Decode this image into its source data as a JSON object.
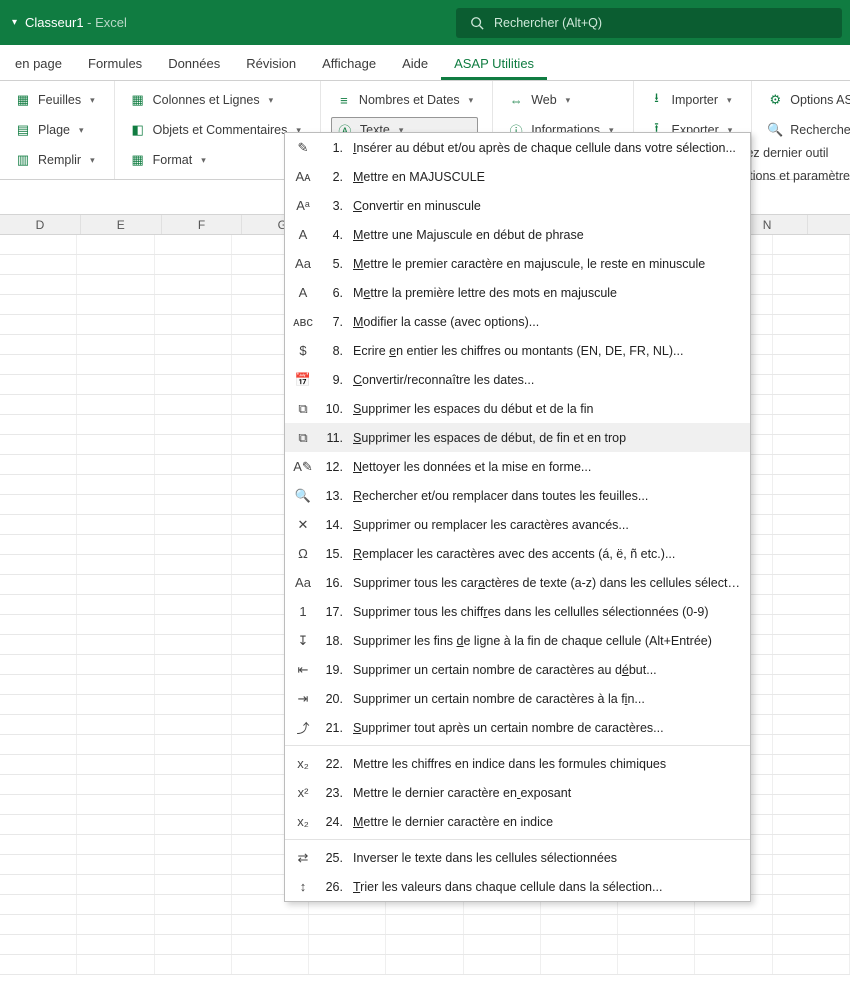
{
  "title": {
    "book": "Classeur1",
    "sep": "  -  ",
    "app": "Excel"
  },
  "search": {
    "placeholder": "Rechercher (Alt+Q)"
  },
  "tabs": [
    "en page",
    "Formules",
    "Données",
    "Révision",
    "Affichage",
    "Aide",
    "ASAP Utilities"
  ],
  "ribbon": {
    "g1": {
      "a": "Feuilles",
      "b": "Plage",
      "c": "Remplir"
    },
    "g2": {
      "a": "Colonnes et Lignes",
      "b": "Objets et Commentaires",
      "c": "Format"
    },
    "g3": {
      "a": "Nombres et Dates",
      "b": "Texte"
    },
    "g4": {
      "a": "Web",
      "b": "Informations"
    },
    "g5": {
      "a": "Importer",
      "b": "Exporter"
    },
    "g6": {
      "a": "Options ASAP Utilities",
      "b": "Rechercher et démarrer un"
    }
  },
  "sidecut": {
    "a": "rez dernier outil",
    "b": "ptions et paramètre"
  },
  "columns": [
    "D",
    "E",
    "F",
    "G",
    "",
    "",
    "",
    "",
    "",
    "N"
  ],
  "menu": [
    {
      "n": "1.",
      "ico": "✎",
      "t": "Insérer au début et/ou après de chaque cellule dans votre sélection...",
      "u": 0
    },
    {
      "n": "2.",
      "ico": "Aᴀ",
      "t": "Mettre en MAJUSCULE",
      "u": 0
    },
    {
      "n": "3.",
      "ico": "Aᵃ",
      "t": "Convertir en minuscule",
      "u": 0
    },
    {
      "n": "4.",
      "ico": "A",
      "t": "Mettre une Majuscule en début de phrase",
      "u": 0
    },
    {
      "n": "5.",
      "ico": "Aa",
      "t": "Mettre le premier caractère en majuscule, le reste en minuscule",
      "u": 0
    },
    {
      "n": "6.",
      "ico": "A",
      "t": "Mettre la première lettre des mots en majuscule",
      "u": 1
    },
    {
      "n": "7.",
      "ico": "ᴀʙᴄ",
      "t": "Modifier la casse (avec options)...",
      "u": 0
    },
    {
      "n": "8.",
      "ico": "$",
      "t": "Ecrire en entier les chiffres ou montants (EN, DE, FR, NL)...",
      "u": 7
    },
    {
      "n": "9.",
      "ico": "📅",
      "t": "Convertir/reconnaître les dates...",
      "u": 0
    },
    {
      "n": "10.",
      "ico": "⧉",
      "t": "Supprimer les espaces du début et de la fin",
      "u": 0
    },
    {
      "n": "11.",
      "ico": "⧉",
      "t": "Supprimer les espaces de début, de fin et en trop",
      "u": 0,
      "hover": true
    },
    {
      "n": "12.",
      "ico": "A✎",
      "t": "Nettoyer les données et la mise en forme...",
      "u": 0
    },
    {
      "n": "13.",
      "ico": "🔍",
      "t": "Rechercher et/ou remplacer dans toutes les feuilles...",
      "u": 0
    },
    {
      "n": "14.",
      "ico": "✕",
      "t": "Supprimer ou remplacer les caractères avancés...",
      "u": 0
    },
    {
      "n": "15.",
      "ico": "Ω",
      "t": "Remplacer les caractères avec des accents (á, ë, ñ etc.)...",
      "u": 0
    },
    {
      "n": "16.",
      "ico": "Aa",
      "t": "Supprimer tous les caractères de texte (a-z) dans les cellules sélectionnées",
      "u": 22
    },
    {
      "n": "17.",
      "ico": "1",
      "t": "Supprimer tous les chiffres dans les cellulles sélectionnées (0-9)",
      "u": 24
    },
    {
      "n": "18.",
      "ico": "↧",
      "t": "Supprimer les fins de ligne à la fin de chaque cellule (Alt+Entrée)",
      "u": 19
    },
    {
      "n": "19.",
      "ico": "⇤",
      "t": "Supprimer un certain nombre de caractères au début...",
      "u": 46
    },
    {
      "n": "20.",
      "ico": "⇥",
      "t": "Supprimer un certain nombre de caractères à la fin...",
      "u": 48
    },
    {
      "n": "21.",
      "ico": "⤴",
      "t": "Supprimer tout après un certain nombre de caractères...",
      "u": 0
    },
    {
      "sep": true
    },
    {
      "n": "22.",
      "ico": "x₂",
      "t": "Mettre les chiffres en indice dans les formules chimiques",
      "u": -1
    },
    {
      "n": "23.",
      "ico": "x²",
      "t": "Mettre le dernier caractère en exposant",
      "u": 30
    },
    {
      "n": "24.",
      "ico": "x₂",
      "t": "Mettre le dernier caractère en indice",
      "u": 0
    },
    {
      "sep": true
    },
    {
      "n": "25.",
      "ico": "⇄",
      "t": "Inverser le texte dans les cellules sélectionnées",
      "u": -1
    },
    {
      "n": "26.",
      "ico": "↕",
      "t": "Trier les valeurs dans chaque cellule dans la sélection...",
      "u": 0
    }
  ]
}
